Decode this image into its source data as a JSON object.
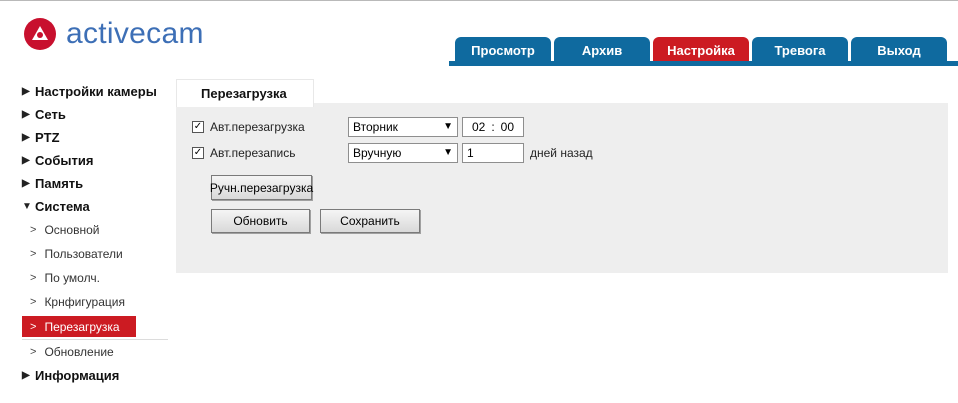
{
  "app": {
    "logo_text": "activecam",
    "brand_color": "#c8102e",
    "logo_text_color": "#3d6fb6"
  },
  "nav": {
    "tabs": [
      {
        "label": "Просмотр",
        "active": false
      },
      {
        "label": "Архив",
        "active": false
      },
      {
        "label": "Настройка",
        "active": true
      },
      {
        "label": "Тревога",
        "active": false
      },
      {
        "label": "Выход",
        "active": false
      }
    ],
    "tab_color": "#0f6a9f",
    "active_color": "#cc1b22"
  },
  "sidebar": {
    "items": [
      {
        "label": "Настройки камеры",
        "arrow": "▶"
      },
      {
        "label": "Сеть",
        "arrow": "▶"
      },
      {
        "label": "PTZ",
        "arrow": "▶"
      },
      {
        "label": "События",
        "arrow": "▶"
      },
      {
        "label": "Память",
        "arrow": "▶"
      },
      {
        "label": "Система",
        "arrow": "▼"
      }
    ],
    "system_subitems": [
      {
        "label": "Основной"
      },
      {
        "label": "Пользователи"
      },
      {
        "label": "По умолч."
      },
      {
        "label": "Крнфигурация"
      },
      {
        "label": "Перезагрузка",
        "active": true
      },
      {
        "label": "Обновление"
      }
    ],
    "last_item": {
      "label": "Информация",
      "arrow": "▶"
    }
  },
  "content": {
    "tab_title": "Перезагрузка",
    "auto_reboot": {
      "checked": true,
      "label": "Авт.перезагрузка",
      "day_value": "Вторник",
      "hour": "02",
      "minute": "00"
    },
    "auto_overwrite": {
      "checked": true,
      "label": "Авт.перезапись",
      "mode_value": "Вручную",
      "days_value": "1",
      "days_suffix": "дней назад"
    },
    "manual_reboot_button": "Ручн.перезагрузка",
    "refresh_button": "Обновить",
    "save_button": "Сохранить"
  }
}
